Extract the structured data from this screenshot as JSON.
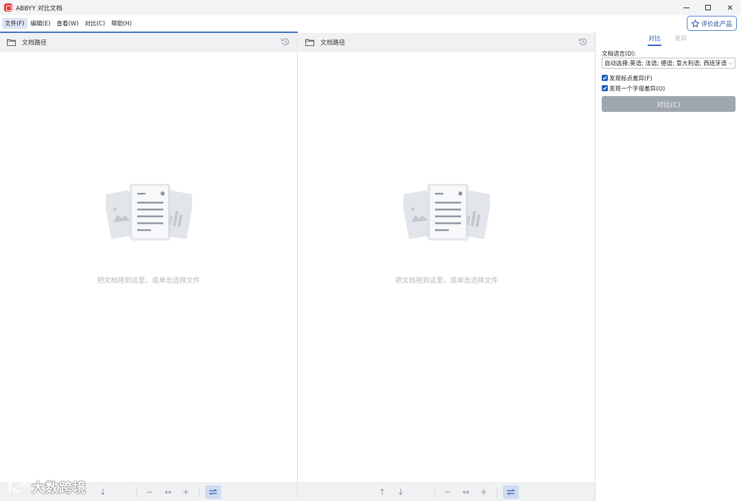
{
  "window": {
    "title": "ABBYY 对比文档"
  },
  "menu": {
    "items": [
      "文件(F)",
      "编辑(E)",
      "查看(W)",
      "对比(C)",
      "帮助(H)"
    ],
    "rate_label": "评价此产品"
  },
  "left_pane": {
    "path_label": "文档路径",
    "drop_hint": "把文档拖到这里，或单击选择文件"
  },
  "right_pane": {
    "path_label": "文档路径",
    "drop_hint": "把文档拖到这里，或单击选择文件"
  },
  "side_panel": {
    "tabs": [
      "对比",
      "差异"
    ],
    "language_label": "文档语言(D):",
    "language_value": "自动选择:英语; 法语; 德语; 意大利语; 西班牙语",
    "check_punctuation": "发现标点差异(F)",
    "check_letter": "发现一个字母差异(O)",
    "compare_button": "对比(C)"
  },
  "watermark": "大数跨境",
  "icons": {
    "folder": "folder-icon",
    "history": "history-icon",
    "star": "star-icon",
    "up": "arrow-up-icon",
    "down": "arrow-down-icon",
    "zoom_out": "minus-icon",
    "fit_width": "fit-width-icon",
    "zoom_in": "plus-icon",
    "sync": "sync-scroll-icon"
  },
  "colors": {
    "accent": "#3a6fc0",
    "compare_button_disabled": "#9fa6ae",
    "app_icon": "#e63b3b"
  }
}
